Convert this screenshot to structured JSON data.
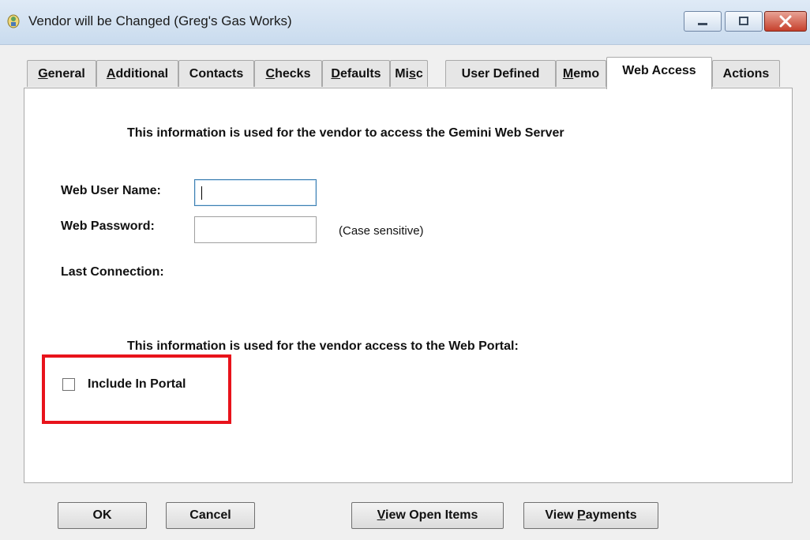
{
  "window": {
    "title": "Vendor will be Changed (Greg's Gas Works)"
  },
  "tabs": [
    {
      "pre": "",
      "u": "G",
      "post": "eneral",
      "active": false
    },
    {
      "pre": "",
      "u": "A",
      "post": "dditional",
      "active": false
    },
    {
      "pre": "Contacts",
      "u": "",
      "post": "",
      "active": false
    },
    {
      "pre": "",
      "u": "C",
      "post": "hecks",
      "active": false
    },
    {
      "pre": "",
      "u": "D",
      "post": "efaults",
      "active": false
    },
    {
      "pre": "Mi",
      "u": "s",
      "post": "c",
      "active": false
    },
    {
      "pre": "User Defined",
      "u": "",
      "post": "",
      "active": false
    },
    {
      "pre": "",
      "u": "M",
      "post": "emo",
      "active": false
    },
    {
      "pre": "Web Access",
      "u": "",
      "post": "",
      "active": true
    },
    {
      "pre": "Actions",
      "u": "",
      "post": "",
      "active": false
    }
  ],
  "web_access": {
    "server_info": "This information is used for the vendor to access the Gemini Web Server",
    "user_name_label": "Web User Name:",
    "user_name_value": "",
    "password_label": "Web Password:",
    "password_value": "",
    "password_hint": "(Case sensitive)",
    "last_connection_label": "Last Connection:",
    "last_connection_value": "",
    "portal_info": "This information is used for the vendor access to the Web Portal:",
    "include_in_portal_label": "Include In Portal",
    "include_in_portal_checked": false
  },
  "buttons": {
    "ok": "OK",
    "cancel": "Cancel",
    "view_open_items_u": "V",
    "view_open_items_rest": "iew Open Items",
    "view_payments_pre": "View ",
    "view_payments_u": "P",
    "view_payments_rest": "ayments"
  },
  "colors": {
    "highlight_border": "#e8131b",
    "focus_border": "#3c7fb1"
  }
}
